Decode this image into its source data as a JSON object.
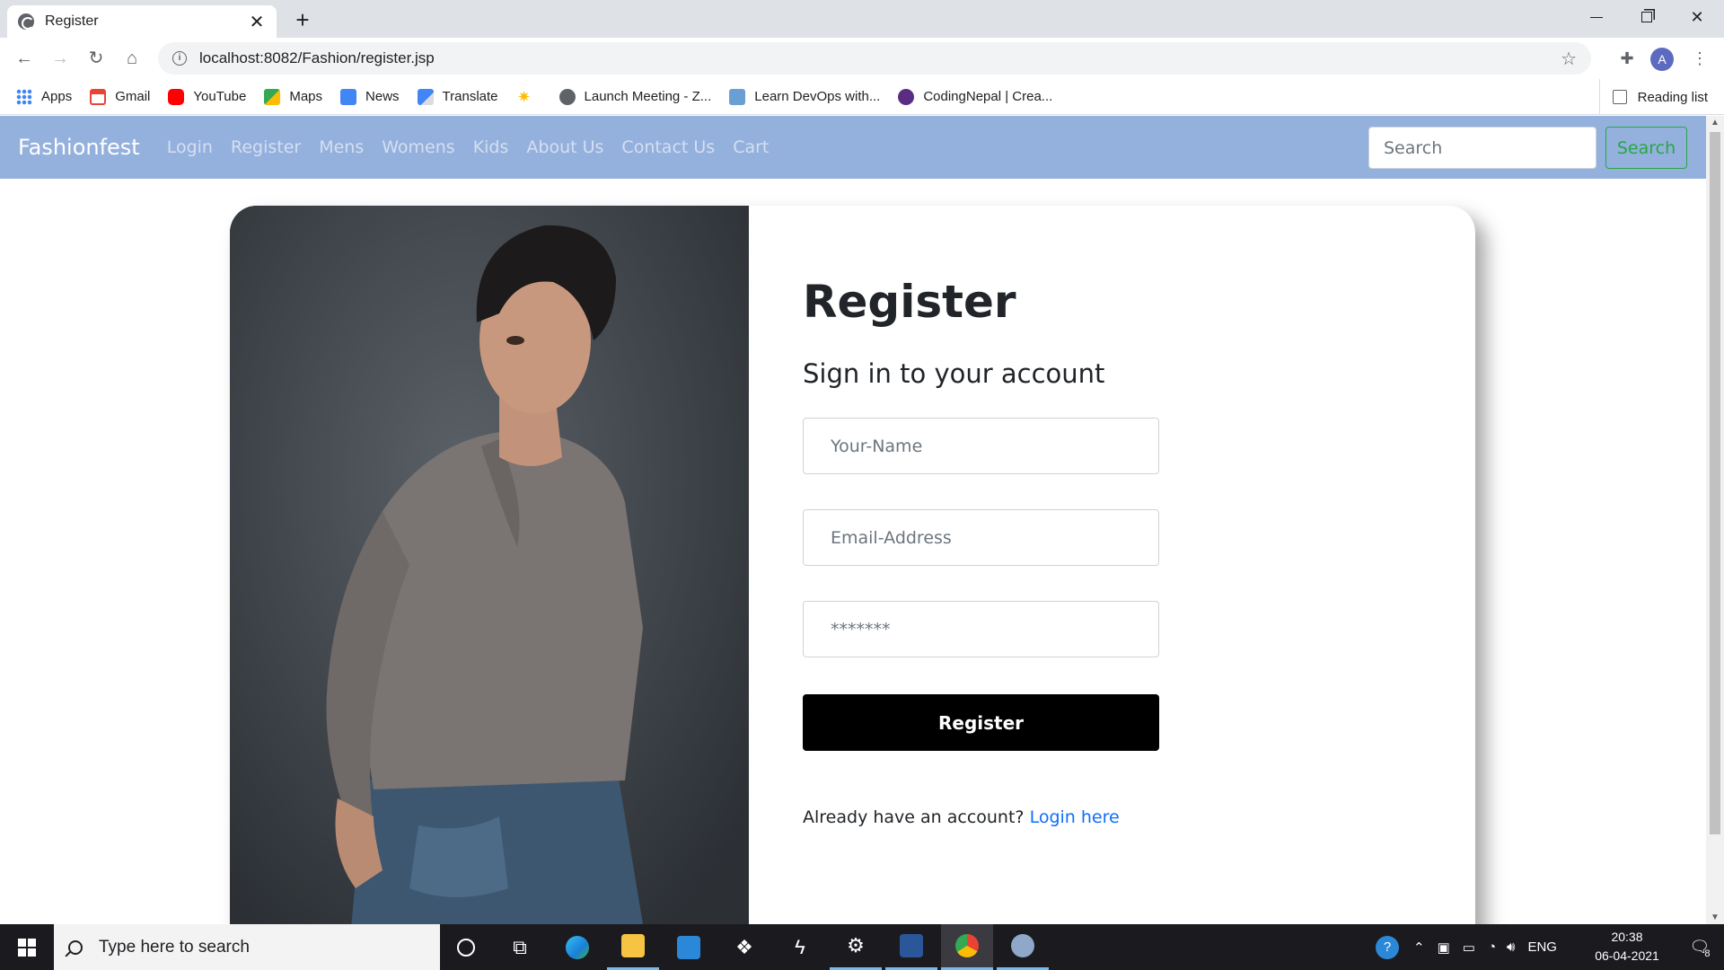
{
  "browser": {
    "tab_title": "Register",
    "new_tab": "+",
    "close_tab": "✕",
    "url": "localhost:8082/Fashion/register.jsp",
    "avatar_letter": "A",
    "bookmarks": [
      {
        "label": "Apps",
        "icon": "apps-grid-icon",
        "color": "#4285f4"
      },
      {
        "label": "Gmail",
        "icon": "gmail-icon",
        "color": "#ea4335"
      },
      {
        "label": "YouTube",
        "icon": "youtube-icon",
        "color": "#ff0000"
      },
      {
        "label": "Maps",
        "icon": "maps-icon",
        "color": "#34a853"
      },
      {
        "label": "News",
        "icon": "news-icon",
        "color": "#4285f4"
      },
      {
        "label": "Translate",
        "icon": "translate-icon",
        "color": "#4285f4"
      },
      {
        "label": "",
        "icon": "star-burst-icon",
        "color": "#fbbc04"
      },
      {
        "label": "Launch Meeting - Z...",
        "icon": "globe-icon",
        "color": "#5f6368"
      },
      {
        "label": "Learn DevOps with...",
        "icon": "devops-icon",
        "color": "#6a9fd4"
      },
      {
        "label": "CodingNepal | Crea...",
        "icon": "codingnepal-icon",
        "color": "#5b2c83"
      }
    ],
    "reading_list": "Reading list"
  },
  "site": {
    "brand": "Fashionfest",
    "nav": [
      "Login",
      "Register",
      "Mens",
      "Womens",
      "Kids",
      "About Us",
      "Contact Us",
      "Cart"
    ],
    "search_placeholder": "Search",
    "search_button": "Search",
    "nav_color": "#94b0dd"
  },
  "form": {
    "title": "Register",
    "subtitle": "Sign in to your account",
    "name_placeholder": "Your-Name",
    "email_placeholder": "Email-Address",
    "password_placeholder": "*******",
    "submit": "Register",
    "already_text": "Already have an account?",
    "login_link": "Login here",
    "link_color": "#0d6efd"
  },
  "taskbar": {
    "search_placeholder": "Type here to search",
    "language": "ENG",
    "time": "20:38",
    "date": "06-04-2021",
    "notification_count": "8"
  }
}
